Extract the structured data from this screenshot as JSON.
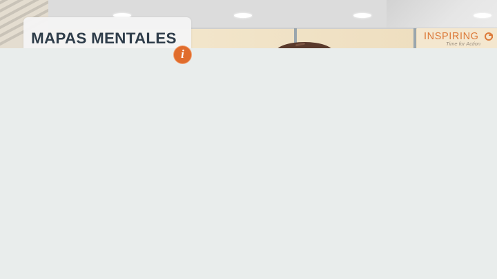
{
  "header": {
    "title": "MAPAS MENTALES"
  },
  "brand": {
    "name": "INSPIRING",
    "tagline": "Time for Action",
    "color": "#dc7a3a"
  },
  "info_button": {
    "icon": "info-icon",
    "glyph": "i",
    "color": "#e06c2c"
  },
  "colors": {
    "title_text": "#2f3d4a",
    "content_background": "#e9edec"
  }
}
